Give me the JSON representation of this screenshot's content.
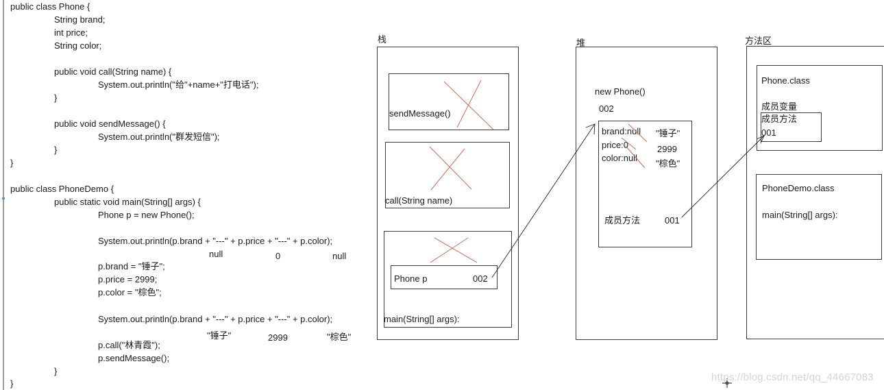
{
  "code": {
    "phone_class": [
      "public class Phone {",
      "String brand;",
      "int price;",
      "String color;",
      "public void call(String name) {",
      "System.out.println(\"给\"+name+\"打电话\");",
      "}",
      "public void sendMessage() {",
      "System.out.println(\"群发短信\");",
      "}",
      "}"
    ],
    "phone_demo_class": [
      "public class PhoneDemo {",
      "public static void main(String[] args) {",
      "Phone p = new Phone();",
      "System.out.println(p.brand + \"---\" + p.price + \"---\" + p.color);",
      "p.brand = \"锤子\";",
      "p.price = 2999;",
      "p.color = \"棕色\";",
      "System.out.println(p.brand + \"---\" + p.price + \"---\" + p.color);",
      "p.call(\"林青霞\");",
      "p.sendMessage();",
      "}",
      "}"
    ],
    "output_annotations_1": [
      "null",
      "0",
      "null"
    ],
    "output_annotations_2": [
      "\"锤子\"",
      "2999",
      "\"棕色\""
    ]
  },
  "memory": {
    "stack": {
      "title": "栈",
      "frames": [
        {
          "label": "sendMessage()",
          "popped": true
        },
        {
          "label": "call(String name)",
          "popped": true
        },
        {
          "label": "main(String[] args):",
          "popped": true,
          "variable": {
            "name": "Phone p",
            "value": "002"
          }
        }
      ]
    },
    "heap": {
      "title": "堆",
      "object_label": "new Phone()",
      "address": "002",
      "fields": [
        {
          "name": "brand:null",
          "new_value": "\"锤子\""
        },
        {
          "name": "price:0",
          "new_value": "2999"
        },
        {
          "name": "color:null",
          "new_value": "\"棕色\""
        }
      ],
      "methods_label": "成员方法",
      "methods_ref": "001"
    },
    "method_area": {
      "title": "方法区",
      "classes": [
        {
          "name": "Phone.class",
          "members_label": "成员变量",
          "methods_label": "成员方法",
          "methods_address": "001"
        },
        {
          "name": "PhoneDemo.class",
          "method": "main(String[] args):"
        }
      ]
    }
  },
  "watermark": "https://blog.csdn.net/qq_44667083",
  "colors": {
    "cross_mark": "#c0705a",
    "stroke": "#3a3a3a"
  }
}
